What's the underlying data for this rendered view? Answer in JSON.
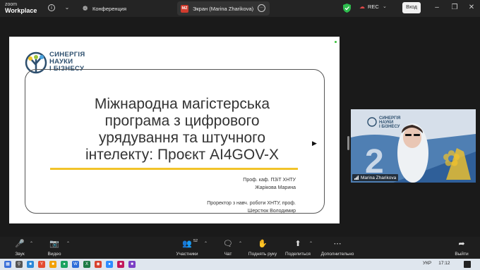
{
  "topbar": {
    "app_brand_line1": "zoom",
    "app_brand_line2": "Workplace",
    "meeting_name": "Конференция",
    "share_avatar": "MZ",
    "share_title": "Экран (Marina Zharikova)",
    "recording_label": "REC",
    "login_button": "Вход"
  },
  "slide": {
    "logo_lines": [
      "СИНЕРГІЯ",
      "НАУКИ",
      "І БІЗНЕСУ"
    ],
    "title": "Міжнародна магістерська програма з цифрового урядування та штучного інтелекту: Проєкт AI4GOV-X",
    "affiliation_1": "Проф. каф. ПЗіТ ХНТУ",
    "name_1": "Жарікова Марина",
    "affiliation_2": "Проректор з навч. роботи ХНТУ, проф.",
    "name_2": "Шерстюк Володимир"
  },
  "thumbnail": {
    "logo_lines": [
      "СИНЕРГІЯ",
      "НАУКИ",
      "І БІЗНЕСУ"
    ],
    "participant_name": "Marina Zharikova"
  },
  "toolbar": {
    "sound": "Звук",
    "video": "Видео",
    "participants": "Участники",
    "participants_count": "52",
    "chat": "Чат",
    "raise_hand": "Поднять руку",
    "share": "Поделиться",
    "more": "Дополнительно",
    "leave": "Выйти"
  },
  "taskbar": {
    "language": "УКР",
    "time": "17:12"
  },
  "colors": {
    "toolbar_bg": "#1e1e1e",
    "accent_yellow": "#f2c32a",
    "rec_red": "#e04848",
    "shield_green": "#2ebd4e"
  }
}
